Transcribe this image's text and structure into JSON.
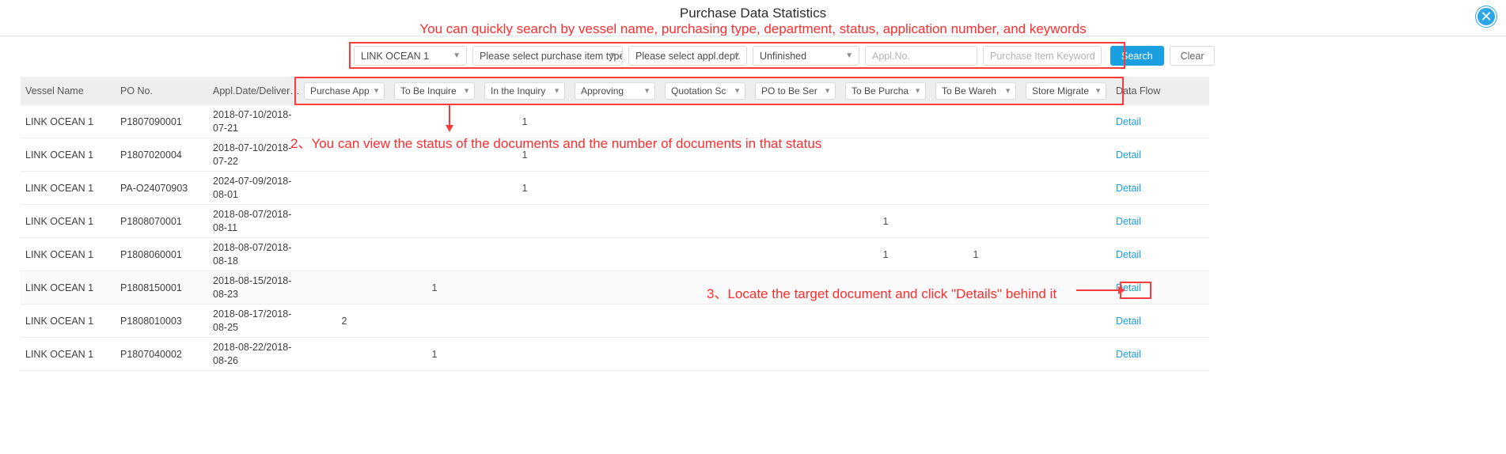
{
  "header": {
    "title": "Purchase Data Statistics",
    "close_icon": "close-icon"
  },
  "annotations": {
    "tip1": "You can quickly search by vessel name, purchasing type, department, status, application number, and keywords",
    "tip2": "2、You can view the status of the documents and the number of documents in that status",
    "tip3": "3、Locate the target document and click \"Details\" behind it"
  },
  "search": {
    "vessel_value": "LINK OCEAN 1",
    "purchase_type_placeholder": "Please select purchase item type.",
    "appl_dept_placeholder": "Please select appl.dept.",
    "status_value": "Unfinished",
    "appl_no_placeholder": "Appl.No.",
    "keyword_placeholder": "Purchase Item Keyword",
    "search_label": "Search",
    "clear_label": "Clear",
    "accent_color": "#1a9fe0"
  },
  "table": {
    "columns": [
      {
        "label": "Vessel Name",
        "type": "text"
      },
      {
        "label": "PO No.",
        "type": "text"
      },
      {
        "label": "Appl.Date/Deliver…",
        "type": "text"
      },
      {
        "label": "Purchase App",
        "type": "select"
      },
      {
        "label": "To Be Inquire",
        "type": "select"
      },
      {
        "label": "In the Inquiry",
        "type": "select"
      },
      {
        "label": "Approving",
        "type": "select"
      },
      {
        "label": "Quotation Sc",
        "type": "select"
      },
      {
        "label": "PO to Be Ser",
        "type": "select"
      },
      {
        "label": "To Be Purcha",
        "type": "select"
      },
      {
        "label": "To Be Wareh",
        "type": "select"
      },
      {
        "label": "Store Migrate",
        "type": "select"
      },
      {
        "label": "Data Flow",
        "type": "text"
      }
    ],
    "detail_label": "Detail",
    "rows": [
      {
        "vessel": "LINK OCEAN 1",
        "po": "P1807090001",
        "date": "2018-07-10/2018-07-21",
        "counts": [
          "",
          "",
          "1",
          "",
          "",
          "",
          "",
          "",
          ""
        ]
      },
      {
        "vessel": "LINK OCEAN 1",
        "po": "P1807020004",
        "date": "2018-07-10/2018-07-22",
        "counts": [
          "",
          "",
          "1",
          "",
          "",
          "",
          "",
          "",
          ""
        ]
      },
      {
        "vessel": "LINK OCEAN 1",
        "po": "PA-O24070903",
        "date": "2024-07-09/2018-08-01",
        "counts": [
          "",
          "",
          "1",
          "",
          "",
          "",
          "",
          "",
          ""
        ]
      },
      {
        "vessel": "LINK OCEAN 1",
        "po": "P1808070001",
        "date": "2018-08-07/2018-08-11",
        "counts": [
          "",
          "",
          "",
          "",
          "",
          "",
          "1",
          "",
          ""
        ]
      },
      {
        "vessel": "LINK OCEAN 1",
        "po": "P1808060001",
        "date": "2018-08-07/2018-08-18",
        "counts": [
          "",
          "",
          "",
          "",
          "",
          "",
          "1",
          "1",
          ""
        ]
      },
      {
        "vessel": "LINK OCEAN 1",
        "po": "P1808150001",
        "date": "2018-08-15/2018-08-23",
        "counts": [
          "",
          "1",
          "",
          "",
          "",
          "",
          "",
          "",
          ""
        ]
      },
      {
        "vessel": "LINK OCEAN 1",
        "po": "P1808010003",
        "date": "2018-08-17/2018-08-25",
        "counts": [
          "2",
          "",
          "",
          "",
          "",
          "",
          "",
          "",
          ""
        ]
      },
      {
        "vessel": "LINK OCEAN 1",
        "po": "P1807040002",
        "date": "2018-08-22/2018-08-26",
        "counts": [
          "",
          "1",
          "",
          "",
          "",
          "",
          "",
          "",
          ""
        ]
      }
    ]
  }
}
